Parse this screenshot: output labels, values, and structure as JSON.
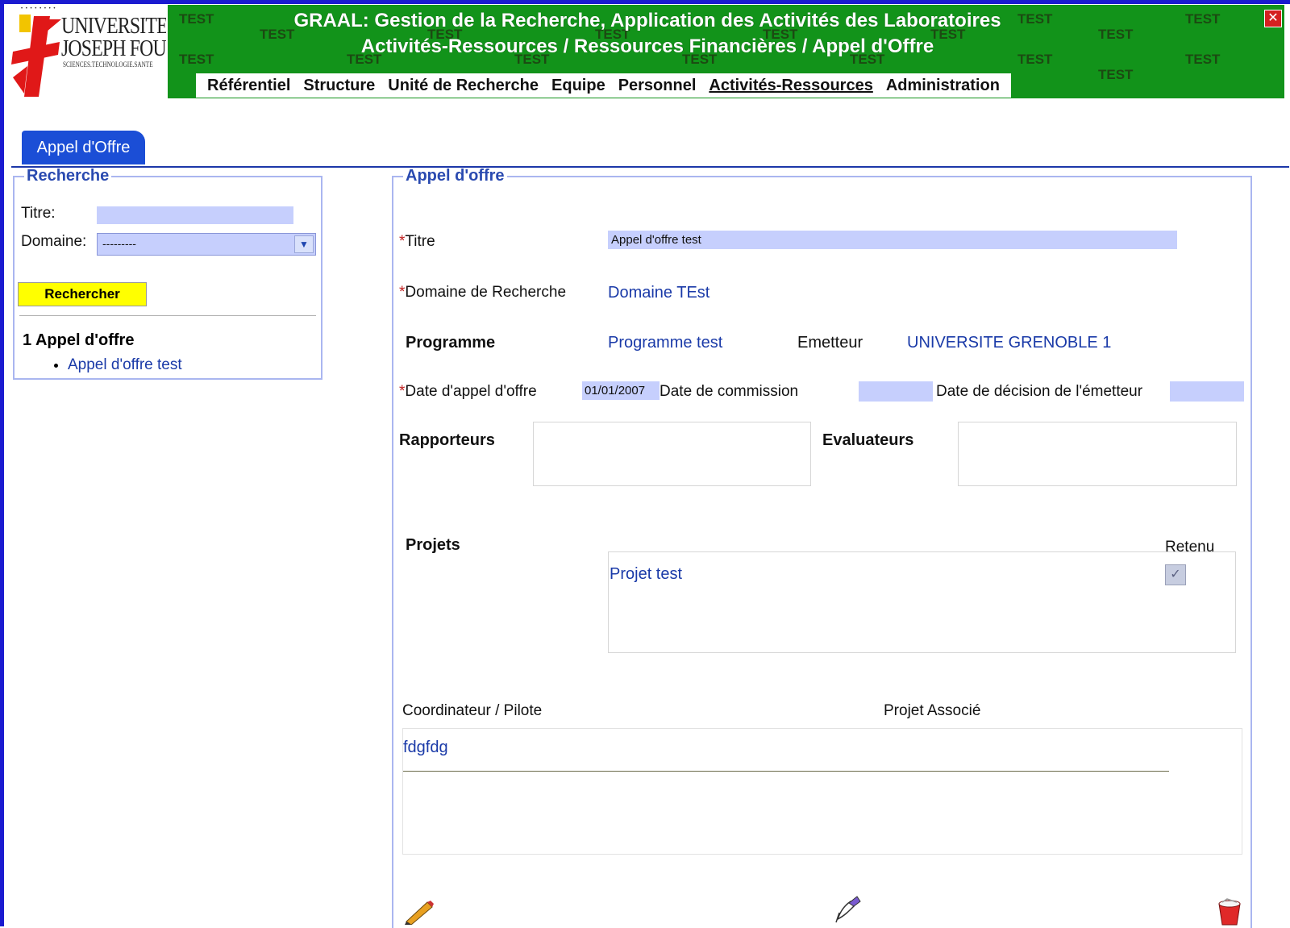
{
  "logo": {
    "line1": "UNIVERSITE",
    "line2": "JOSEPH FOURIER",
    "line3": "SCIENCES.TECHNOLOGIE.SANTE"
  },
  "banner": {
    "title": "GRAAL: Gestion de la Recherche, Application des Activités des Laboratoires",
    "subtitle": "Activités-Ressources / Ressources Financières / Appel d'Offre",
    "watermark": "TEST",
    "close_icon": "close-icon"
  },
  "nav": {
    "items": [
      {
        "label": "Référentiel"
      },
      {
        "label": "Structure"
      },
      {
        "label": "Unité de Recherche"
      },
      {
        "label": "Equipe"
      },
      {
        "label": "Personnel"
      },
      {
        "label": "Activités-Ressources",
        "active": true
      },
      {
        "label": "Administration"
      }
    ]
  },
  "tab": {
    "label": "Appel d'Offre"
  },
  "search": {
    "legend": "Recherche",
    "titre_label": "Titre:",
    "titre_value": "",
    "domaine_label": "Domaine:",
    "domaine_selected": "---------",
    "button_label": "Rechercher",
    "result_count": "1 Appel d'offre",
    "results": [
      "Appel d'offre test"
    ]
  },
  "form": {
    "legend": "Appel d'offre",
    "required_mark": "*",
    "titre_label": "Titre",
    "titre_value": "Appel d'offre test",
    "domaine_label": "Domaine de Recherche",
    "domaine_value": "Domaine TEst",
    "programme_label": "Programme",
    "programme_value": "Programme test",
    "emetteur_label": "Emetteur",
    "emetteur_value": "UNIVERSITE GRENOBLE 1",
    "date_ao_label": "Date d'appel d'offre",
    "date_ao_value": "01/01/2007",
    "date_commission_label": "Date de commission",
    "date_commission_value": "",
    "date_decision_label": "Date de décision de l'émetteur",
    "date_decision_value": "",
    "rapporteurs_label": "Rapporteurs",
    "evaluateurs_label": "Evaluateurs",
    "projets_label": "Projets",
    "retenu_label": "Retenu",
    "projets": [
      {
        "name": "Projet test",
        "retenu": true
      }
    ],
    "coordinateur_label": "Coordinateur / Pilote",
    "projet_associe_label": "Projet Associé",
    "coordinateur_value": "fdgfdg"
  },
  "actions": {
    "edit_icon": "pencil-icon",
    "link_icon": "quill-icon",
    "delete_icon": "trash-icon"
  },
  "colors": {
    "banner_green": "#12931a",
    "tab_blue": "#1b4ed6",
    "field_fill": "#c6cffd",
    "button_yellow": "#ffff00",
    "link_blue": "#1a3aa8",
    "required_red": "#c02020"
  }
}
